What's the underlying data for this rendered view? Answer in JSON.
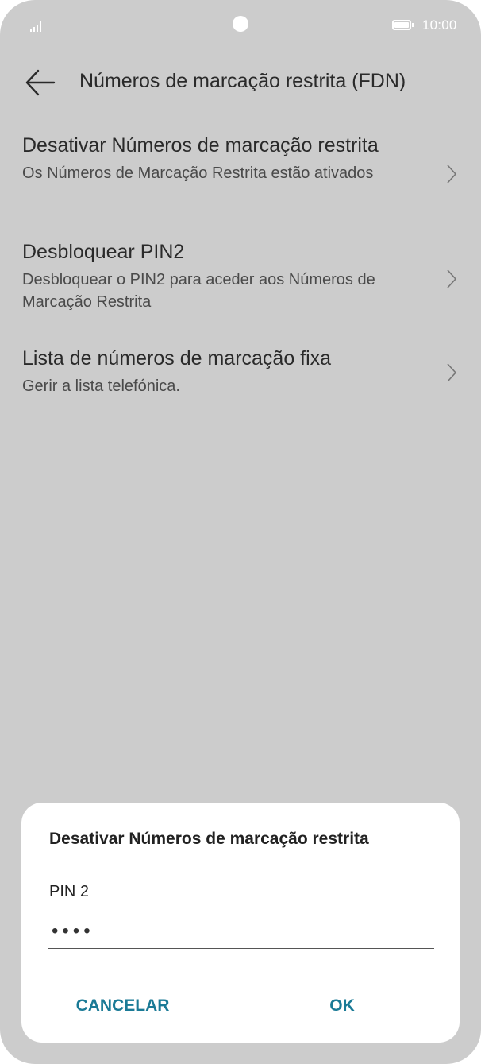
{
  "status_bar": {
    "time": "10:00",
    "signal_icon": "signal-icon",
    "battery_icon": "battery-icon"
  },
  "header": {
    "title": "Números de marcação restrita (FDN)",
    "back_icon": "back-arrow-icon"
  },
  "list": {
    "items": [
      {
        "title": "Desativar Números de marcação restrita",
        "subtitle": "Os Números de Marcação Restrita estão ativados"
      },
      {
        "title": "Desbloquear PIN2",
        "subtitle": "Desbloquear o PIN2 para aceder aos Números de Marcação Restrita"
      },
      {
        "title": "Lista de números de marcação fixa",
        "subtitle": "Gerir a lista telefónica."
      }
    ]
  },
  "dialog": {
    "title": "Desativar Números de marcação restrita",
    "field_label": "PIN 2",
    "field_value": "••••",
    "cancel_label": "CANCELAR",
    "ok_label": "OK"
  },
  "colors": {
    "overlay_background": "#cccccc",
    "dialog_background": "#ffffff",
    "accent": "#1a7a96",
    "text_primary": "#2a2a2a"
  }
}
